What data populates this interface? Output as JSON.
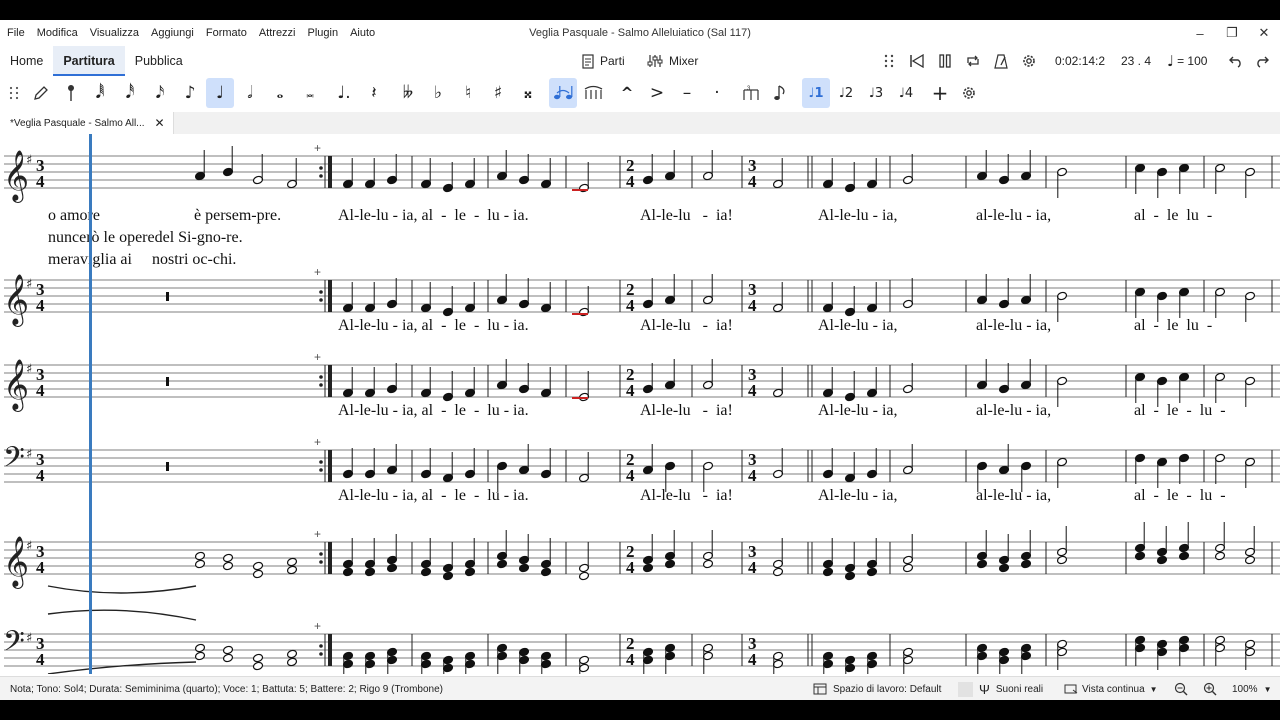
{
  "menu": [
    "File",
    "Modifica",
    "Visualizza",
    "Aggiungi",
    "Formato",
    "Attrezzi",
    "Plugin",
    "Aiuto"
  ],
  "window_title": "Veglia Pasquale - Salmo Alleluiatico (Sal 117)",
  "mode_tabs": [
    "Home",
    "Partitura",
    "Pubblica"
  ],
  "parts_label": "Parti",
  "mixer_label": "Mixer",
  "playback_time": "0:02:14:2",
  "measure_beat": "23 . 4",
  "tempo": "= 100",
  "document_tab": "*Veglia Pasquale - Salmo All...",
  "lyrics": {
    "verse1_intro": [
      "o amore",
      "è persem-pre."
    ],
    "verse2_intro": "nuncerò le operedel Si-gno-re.",
    "verse3_intro": "meraviglia ai     nostri oc-chi.",
    "alleluia": [
      "Al-le-lu - ia, al  -  le  -  lu - ia.",
      "Al-le-lu   -  ia!",
      "Al-le-lu - ia,",
      "al-le-lu - ia,",
      "al  -  le  lu  -"
    ],
    "alleluia_lower": [
      "Al-le-lu - ia, al  -  le  -  lu - ia.",
      "Al-le-lu   -  ia!",
      "Al-le-lu - ia,",
      "al-le-lu - ia,",
      "al  -  le  -  lu  -"
    ]
  },
  "status": {
    "note_info": "Nota; Tono: Sol4; Durata: Semiminima (quarto); Voce: 1; Battuta: 5; Battere: 2; Rigo 9 (Trombone)",
    "workspace": "Spazio di lavoro: Default",
    "real_sounds": "Suoni reali",
    "view_mode": "Vista continua",
    "zoom": "100%"
  },
  "colors": {
    "accent": "#2f6fd6",
    "active_bg": "#cfe0fb",
    "playhead": "#3a7bbf",
    "selection": "#cc2222"
  },
  "icons": [
    "file-icon",
    "mixer-icon",
    "drag-handle-icon",
    "rewind-icon",
    "play-icon",
    "loop-icon",
    "metronome-icon",
    "settings-icon",
    "undo-icon",
    "redo-icon",
    "pen-icon",
    "plus-icon"
  ]
}
